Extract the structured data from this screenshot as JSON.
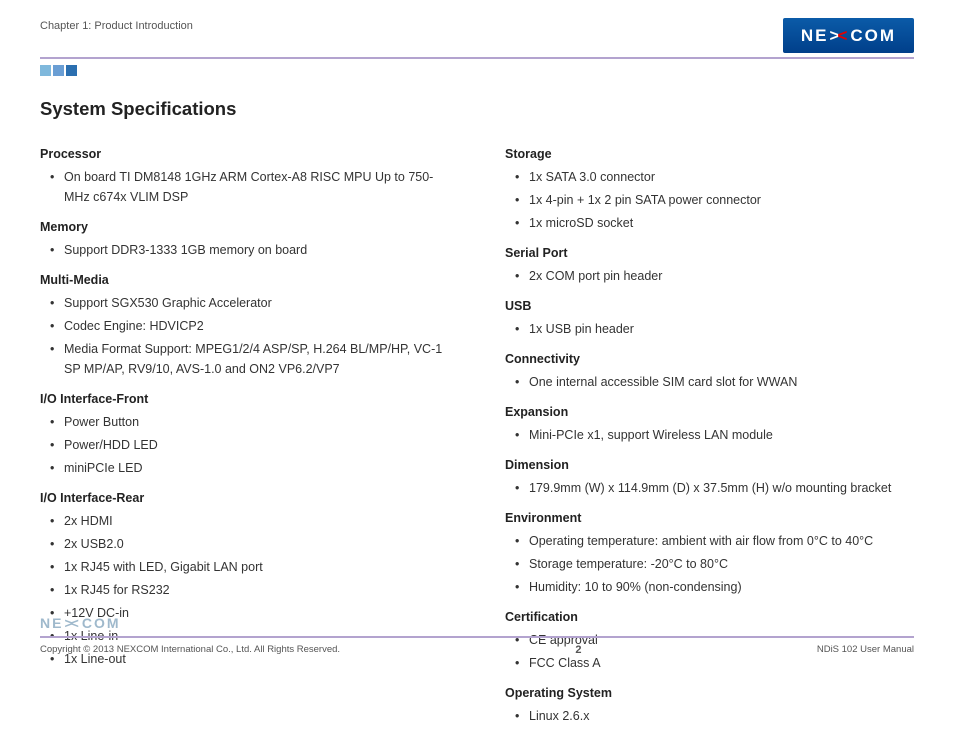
{
  "header": {
    "chapter": "Chapter 1: Product Introduction",
    "logo_left": "NE",
    "logo_right": "COM"
  },
  "title": "System Specifications",
  "left_sections": [
    {
      "heading": "Processor",
      "items": [
        "On board TI DM8148 1GHz ARM Cortex-A8 RISC MPU Up to 750-MHz c674x VLIM DSP"
      ]
    },
    {
      "heading": "Memory",
      "items": [
        "Support DDR3-1333 1GB memory on board"
      ]
    },
    {
      "heading": "Multi-Media",
      "items": [
        "Support SGX530 Graphic Accelerator",
        "Codec Engine: HDVICP2",
        "Media Format Support: MPEG1/2/4 ASP/SP, H.264 BL/MP/HP, VC-1 SP MP/AP, RV9/10, AVS-1.0 and ON2 VP6.2/VP7"
      ]
    },
    {
      "heading": "I/O Interface-Front",
      "items": [
        "Power Button",
        "Power/HDD LED",
        "miniPCIe LED"
      ]
    },
    {
      "heading": "I/O Interface-Rear",
      "items": [
        "2x HDMI",
        "2x USB2.0",
        "1x RJ45 with LED, Gigabit LAN port",
        "1x RJ45 for RS232",
        "+12V DC-in",
        "1x Line-in",
        "1x Line-out"
      ]
    }
  ],
  "right_sections": [
    {
      "heading": "Storage",
      "items": [
        "1x SATA 3.0 connector",
        "1x 4-pin + 1x 2 pin SATA power connector",
        "1x microSD socket"
      ]
    },
    {
      "heading": "Serial Port",
      "items": [
        "2x COM port pin header"
      ]
    },
    {
      "heading": "USB",
      "items": [
        "1x USB pin header"
      ]
    },
    {
      "heading": "Connectivity",
      "items": [
        "One internal accessible SIM card slot for WWAN"
      ]
    },
    {
      "heading": "Expansion",
      "items": [
        "Mini-PCIe x1, support Wireless LAN module"
      ]
    },
    {
      "heading": "Dimension",
      "items": [
        "179.9mm (W) x 114.9mm (D) x 37.5mm (H) w/o mounting bracket"
      ]
    },
    {
      "heading": "Environment",
      "items": [
        "Operating temperature: ambient with air flow from 0°C to 40°C",
        "Storage temperature: -20°C to 80°C",
        "Humidity: 10 to 90% (non-condensing)"
      ]
    },
    {
      "heading": "Certification",
      "items": [
        "CE approval",
        "FCC Class A"
      ]
    },
    {
      "heading": "Operating System",
      "items": [
        "Linux 2.6.x"
      ]
    }
  ],
  "footer": {
    "copyright": "Copyright © 2013 NEXCOM International Co., Ltd. All Rights Reserved.",
    "page": "2",
    "doc": "NDiS 102 User Manual",
    "logo_left": "NE",
    "logo_right": "COM"
  }
}
